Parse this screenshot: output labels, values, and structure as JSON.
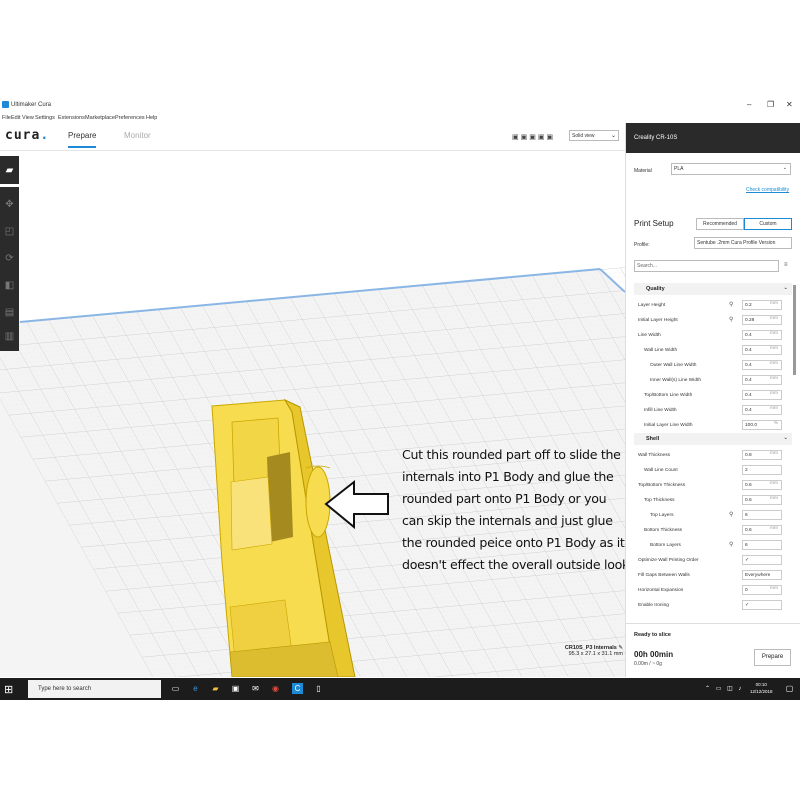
{
  "window": {
    "title": "Ultimaker Cura",
    "controls": [
      "–",
      "❐",
      "✕"
    ]
  },
  "menu": [
    "File",
    "Edit",
    "View",
    "Settings",
    "Extensions",
    "Marketplace",
    "Preferences",
    "Help"
  ],
  "header": {
    "logo": "cura",
    "tabs": [
      {
        "label": "Prepare",
        "active": true
      },
      {
        "label": "Monitor",
        "active": false
      }
    ],
    "view_mode": "Solid view"
  },
  "annotation": {
    "lines": [
      "Cut this rounded part off to slide the",
      "internals into P1 Body and glue the",
      "rounded part onto P1 Body or you",
      "can skip the internals and just glue",
      "the rounded peice onto P1 Body as it",
      "doesn't effect the overall outside look"
    ]
  },
  "object": {
    "name": "CR10S_P3 Internals",
    "dimensions": "95.3 x 27.1 x 31.1 mm"
  },
  "panel": {
    "printer": "Creality CR-10S",
    "material_label": "Material",
    "material_value": "PLA",
    "compatibility_link": "Check compatibility",
    "print_setup_title": "Print Setup",
    "mode_recommended": "Recommended",
    "mode_custom": "Custom",
    "profile_label": "Profile:",
    "profile_value": "Sentube .2mm Cura Profile Version",
    "search_placeholder": "Search...",
    "quality_section": "Quality",
    "shell_section": "Shell",
    "quality_rows": [
      {
        "label": "Layer Height",
        "value": "0.2",
        "unit": "mm",
        "indent": 0,
        "link": true
      },
      {
        "label": "Initial Layer Height",
        "value": "0.28",
        "unit": "mm",
        "indent": 0,
        "link": true
      },
      {
        "label": "Line Width",
        "value": "0.4",
        "unit": "mm",
        "indent": 0,
        "link": false
      },
      {
        "label": "Wall Line Width",
        "value": "0.4",
        "unit": "mm",
        "indent": 1,
        "link": false
      },
      {
        "label": "Outer Wall Line Width",
        "value": "0.4",
        "unit": "mm",
        "indent": 2,
        "link": false
      },
      {
        "label": "Inner Wall(s) Line Width",
        "value": "0.4",
        "unit": "mm",
        "indent": 2,
        "link": false
      },
      {
        "label": "Top/Bottom Line Width",
        "value": "0.4",
        "unit": "mm",
        "indent": 1,
        "link": false
      },
      {
        "label": "Infill Line Width",
        "value": "0.4",
        "unit": "mm",
        "indent": 1,
        "link": false
      },
      {
        "label": "Initial Layer Line Width",
        "value": "100.0",
        "unit": "%",
        "indent": 1,
        "link": false
      }
    ],
    "shell_rows": [
      {
        "label": "Wall Thickness",
        "value": "0.8",
        "unit": "mm",
        "indent": 0,
        "link": false
      },
      {
        "label": "Wall Line Count",
        "value": "2",
        "unit": "",
        "indent": 1,
        "link": false
      },
      {
        "label": "Top/Bottom Thickness",
        "value": "0.6",
        "unit": "mm",
        "indent": 0,
        "link": false
      },
      {
        "label": "Top Thickness",
        "value": "0.6",
        "unit": "mm",
        "indent": 1,
        "link": false
      },
      {
        "label": "Top Layers",
        "value": "6",
        "unit": "",
        "indent": 2,
        "link": true
      },
      {
        "label": "Bottom Thickness",
        "value": "0.6",
        "unit": "mm",
        "indent": 1,
        "link": false
      },
      {
        "label": "Bottom Layers",
        "value": "6",
        "unit": "",
        "indent": 2,
        "link": true
      },
      {
        "label": "Optimize Wall Printing Order",
        "value": "✓",
        "unit": "",
        "indent": 0,
        "link": false
      },
      {
        "label": "Fill Gaps Between Walls",
        "value": "Everywhere",
        "unit": "",
        "indent": 0,
        "link": false
      },
      {
        "label": "Horizontal Expansion",
        "value": "0",
        "unit": "mm",
        "indent": 0,
        "link": false
      },
      {
        "label": "Enable Ironing",
        "value": "✓",
        "unit": "",
        "indent": 0,
        "link": false
      }
    ],
    "ready_label": "Ready to slice",
    "time": "00h 00min",
    "material_usage": "0.00m / ~ 0g",
    "prepare_button": "Prepare"
  },
  "taskbar": {
    "search_placeholder": "Type here to search",
    "time": "00:10",
    "date": "12/12/2018"
  },
  "colors": {
    "accent": "#1e8ad6",
    "model": "#f7dc4f",
    "dark": "#2a2a2a"
  }
}
